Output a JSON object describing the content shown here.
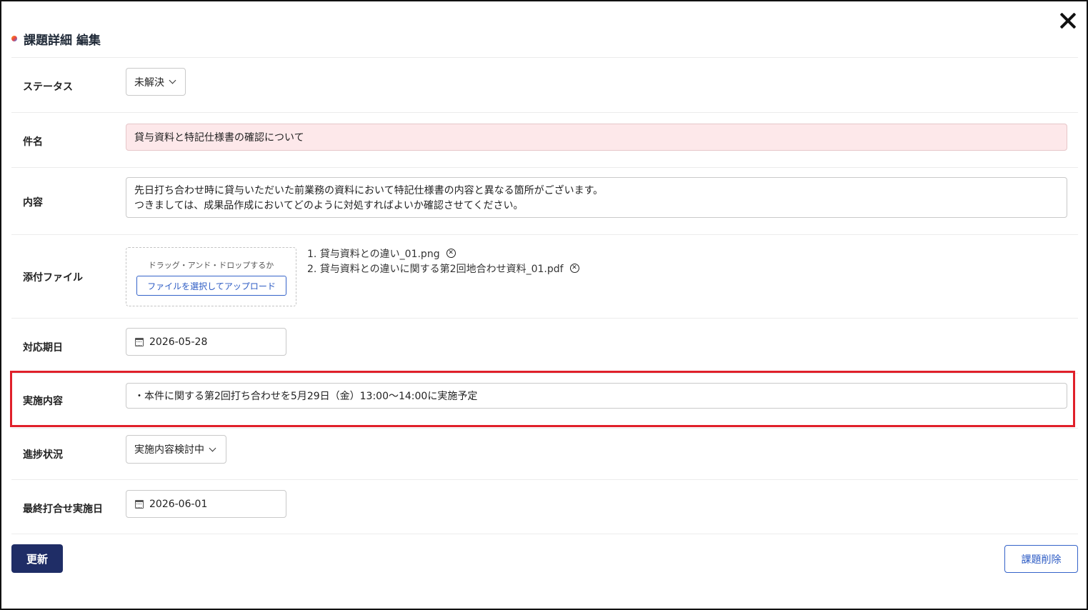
{
  "dialog": {
    "title": "課題詳細 編集",
    "close_icon": "close-icon"
  },
  "fields": {
    "status": {
      "label": "ステータス",
      "value": "未解決"
    },
    "subject": {
      "label": "件名",
      "value": "貸与資料と特記仕様書の確認について"
    },
    "content": {
      "label": "内容",
      "lines": [
        "先日打ち合わせ時に貸与いただいた前業務の資料において特記仕様書の内容と異なる箇所がございます。",
        "つきましては、成果品作成においてどのように対処すればよいか確認させてください。"
      ]
    },
    "attachments": {
      "label": "添付ファイル",
      "drop_hint": "ドラッグ・アンド・ドロップするか",
      "upload_label": "ファイルを選択してアップロード",
      "files": [
        "1. 貸与資料との違い_01.png",
        "2. 貸与資料との違いに関する第2回地合わせ資料_01.pdf"
      ]
    },
    "due_date": {
      "label": "対応期日",
      "value": "2026-05-28"
    },
    "action": {
      "label": "実施内容",
      "value": "・本件に関する第2回打ち合わせを5月29日（金）13:00～14:00に実施予定"
    },
    "progress": {
      "label": "進捗状況",
      "value": "実施内容検討中"
    },
    "last_meeting": {
      "label": "最終打合せ実施日",
      "value": "2026-06-01"
    }
  },
  "buttons": {
    "update": "更新",
    "delete": "課題削除"
  },
  "colors": {
    "primary": "#1f2d66",
    "link": "#2c5bc4",
    "highlight": "#e0202a",
    "pink_input": "#fde8ea"
  }
}
